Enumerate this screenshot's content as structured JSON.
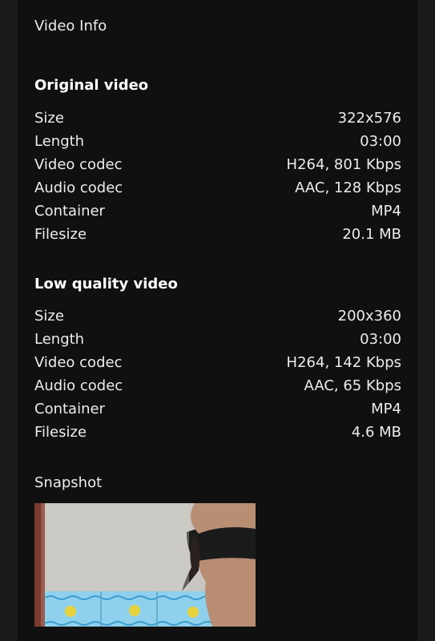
{
  "header": {
    "title": "Video Info"
  },
  "original": {
    "title": "Original video",
    "rows": [
      {
        "label": "Size",
        "value": "322x576"
      },
      {
        "label": "Length",
        "value": "03:00"
      },
      {
        "label": "Video codec",
        "value": "H264, 801 Kbps"
      },
      {
        "label": "Audio codec",
        "value": "AAC, 128 Kbps"
      },
      {
        "label": "Container",
        "value": "MP4"
      },
      {
        "label": "Filesize",
        "value": "20.1 MB"
      }
    ]
  },
  "low": {
    "title": "Low quality video",
    "rows": [
      {
        "label": "Size",
        "value": "200x360"
      },
      {
        "label": "Length",
        "value": "03:00"
      },
      {
        "label": "Video codec",
        "value": "H264, 142 Kbps"
      },
      {
        "label": "Audio codec",
        "value": "AAC, 65 Kbps"
      },
      {
        "label": "Container",
        "value": "MP4"
      },
      {
        "label": "Filesize",
        "value": "4.6 MB"
      }
    ]
  },
  "snapshot": {
    "label": "Snapshot"
  }
}
